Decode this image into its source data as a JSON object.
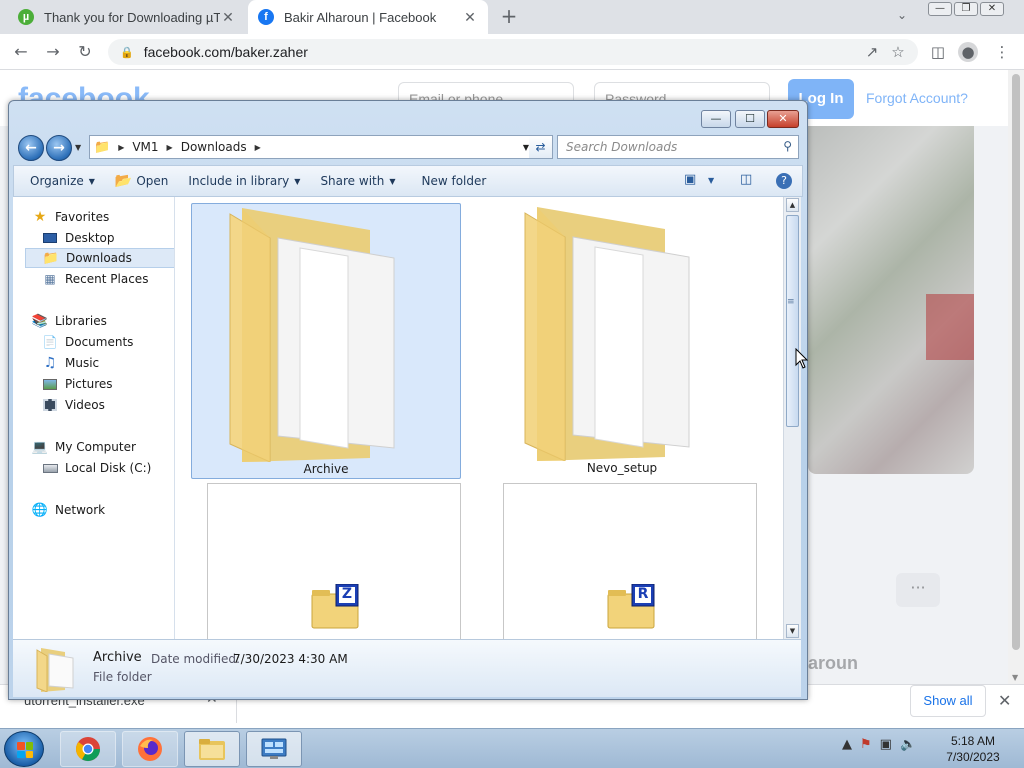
{
  "browser": {
    "tabs": [
      {
        "title": "Thank you for Downloading µTor",
        "icon": "utorrent-icon",
        "active": false
      },
      {
        "title": "Bakir Alharoun | Facebook",
        "icon": "facebook-icon",
        "active": true
      }
    ],
    "new_tab": "+",
    "url": "facebook.com/baker.zaher"
  },
  "facebook": {
    "logo": "facebook",
    "email_placeholder": "Email or phone",
    "password_placeholder": "Password",
    "login_label": "Log In",
    "forgot_label": "Forgot Account?",
    "more_label": "···",
    "profile_name_partial": "lharoun"
  },
  "downloads": {
    "file": "utorrent_installer.exe",
    "show_all": "Show all"
  },
  "explorer": {
    "breadcrumb": [
      "VM1",
      "Downloads"
    ],
    "search_placeholder": "Search Downloads",
    "commands": {
      "organize": "Organize",
      "open": "Open",
      "include_in_library": "Include in library",
      "share_with": "Share with",
      "new_folder": "New folder"
    },
    "nav": {
      "favorites": "Favorites",
      "desktop": "Desktop",
      "downloads": "Downloads",
      "recent_places": "Recent Places",
      "libraries": "Libraries",
      "documents": "Documents",
      "music": "Music",
      "pictures": "Pictures",
      "videos": "Videos",
      "my_computer": "My Computer",
      "local_disk": "Local Disk (C:)",
      "network": "Network"
    },
    "items": [
      {
        "name": "Archive",
        "selected": true
      },
      {
        "name": "Nevo_setup",
        "selected": false
      },
      {
        "name": "",
        "badge": "Z"
      },
      {
        "name": "",
        "badge": "R"
      }
    ],
    "details": {
      "name": "Archive",
      "modified_label": "Date modified:",
      "modified_value": "7/30/2023 4:30 AM",
      "type": "File folder"
    }
  },
  "taskbar": {
    "time": "5:18 AM",
    "date": "7/30/2023"
  },
  "colors": {
    "facebook_blue": "#1877f2",
    "selection": "#d9e8fb",
    "taskbar": "#b9cee3"
  }
}
